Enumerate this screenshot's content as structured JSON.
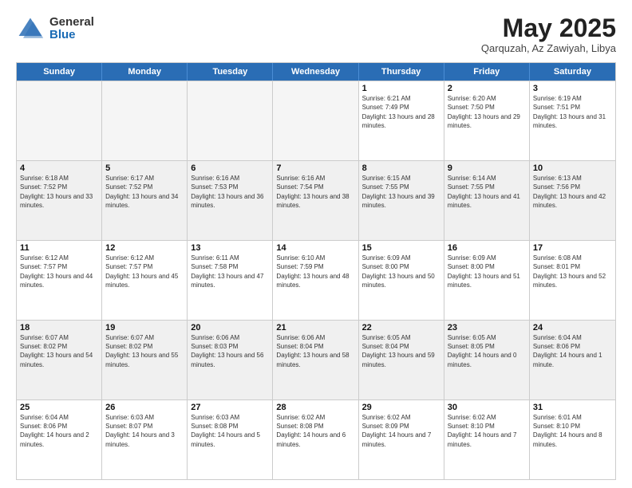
{
  "header": {
    "logo_general": "General",
    "logo_blue": "Blue",
    "month_title": "May 2025",
    "location": "Qarquzah, Az Zawiyah, Libya"
  },
  "weekdays": [
    "Sunday",
    "Monday",
    "Tuesday",
    "Wednesday",
    "Thursday",
    "Friday",
    "Saturday"
  ],
  "rows": [
    [
      {
        "day": "",
        "empty": true
      },
      {
        "day": "",
        "empty": true
      },
      {
        "day": "",
        "empty": true
      },
      {
        "day": "",
        "empty": true
      },
      {
        "day": "1",
        "sunrise": "6:21 AM",
        "sunset": "7:49 PM",
        "daylight": "13 hours and 28 minutes."
      },
      {
        "day": "2",
        "sunrise": "6:20 AM",
        "sunset": "7:50 PM",
        "daylight": "13 hours and 29 minutes."
      },
      {
        "day": "3",
        "sunrise": "6:19 AM",
        "sunset": "7:51 PM",
        "daylight": "13 hours and 31 minutes."
      }
    ],
    [
      {
        "day": "4",
        "sunrise": "6:18 AM",
        "sunset": "7:52 PM",
        "daylight": "13 hours and 33 minutes."
      },
      {
        "day": "5",
        "sunrise": "6:17 AM",
        "sunset": "7:52 PM",
        "daylight": "13 hours and 34 minutes."
      },
      {
        "day": "6",
        "sunrise": "6:16 AM",
        "sunset": "7:53 PM",
        "daylight": "13 hours and 36 minutes."
      },
      {
        "day": "7",
        "sunrise": "6:16 AM",
        "sunset": "7:54 PM",
        "daylight": "13 hours and 38 minutes."
      },
      {
        "day": "8",
        "sunrise": "6:15 AM",
        "sunset": "7:55 PM",
        "daylight": "13 hours and 39 minutes."
      },
      {
        "day": "9",
        "sunrise": "6:14 AM",
        "sunset": "7:55 PM",
        "daylight": "13 hours and 41 minutes."
      },
      {
        "day": "10",
        "sunrise": "6:13 AM",
        "sunset": "7:56 PM",
        "daylight": "13 hours and 42 minutes."
      }
    ],
    [
      {
        "day": "11",
        "sunrise": "6:12 AM",
        "sunset": "7:57 PM",
        "daylight": "13 hours and 44 minutes."
      },
      {
        "day": "12",
        "sunrise": "6:12 AM",
        "sunset": "7:57 PM",
        "daylight": "13 hours and 45 minutes."
      },
      {
        "day": "13",
        "sunrise": "6:11 AM",
        "sunset": "7:58 PM",
        "daylight": "13 hours and 47 minutes."
      },
      {
        "day": "14",
        "sunrise": "6:10 AM",
        "sunset": "7:59 PM",
        "daylight": "13 hours and 48 minutes."
      },
      {
        "day": "15",
        "sunrise": "6:09 AM",
        "sunset": "8:00 PM",
        "daylight": "13 hours and 50 minutes."
      },
      {
        "day": "16",
        "sunrise": "6:09 AM",
        "sunset": "8:00 PM",
        "daylight": "13 hours and 51 minutes."
      },
      {
        "day": "17",
        "sunrise": "6:08 AM",
        "sunset": "8:01 PM",
        "daylight": "13 hours and 52 minutes."
      }
    ],
    [
      {
        "day": "18",
        "sunrise": "6:07 AM",
        "sunset": "8:02 PM",
        "daylight": "13 hours and 54 minutes."
      },
      {
        "day": "19",
        "sunrise": "6:07 AM",
        "sunset": "8:02 PM",
        "daylight": "13 hours and 55 minutes."
      },
      {
        "day": "20",
        "sunrise": "6:06 AM",
        "sunset": "8:03 PM",
        "daylight": "13 hours and 56 minutes."
      },
      {
        "day": "21",
        "sunrise": "6:06 AM",
        "sunset": "8:04 PM",
        "daylight": "13 hours and 58 minutes."
      },
      {
        "day": "22",
        "sunrise": "6:05 AM",
        "sunset": "8:04 PM",
        "daylight": "13 hours and 59 minutes."
      },
      {
        "day": "23",
        "sunrise": "6:05 AM",
        "sunset": "8:05 PM",
        "daylight": "14 hours and 0 minutes."
      },
      {
        "day": "24",
        "sunrise": "6:04 AM",
        "sunset": "8:06 PM",
        "daylight": "14 hours and 1 minute."
      }
    ],
    [
      {
        "day": "25",
        "sunrise": "6:04 AM",
        "sunset": "8:06 PM",
        "daylight": "14 hours and 2 minutes."
      },
      {
        "day": "26",
        "sunrise": "6:03 AM",
        "sunset": "8:07 PM",
        "daylight": "14 hours and 3 minutes."
      },
      {
        "day": "27",
        "sunrise": "6:03 AM",
        "sunset": "8:08 PM",
        "daylight": "14 hours and 5 minutes."
      },
      {
        "day": "28",
        "sunrise": "6:02 AM",
        "sunset": "8:08 PM",
        "daylight": "14 hours and 6 minutes."
      },
      {
        "day": "29",
        "sunrise": "6:02 AM",
        "sunset": "8:09 PM",
        "daylight": "14 hours and 7 minutes."
      },
      {
        "day": "30",
        "sunrise": "6:02 AM",
        "sunset": "8:10 PM",
        "daylight": "14 hours and 7 minutes."
      },
      {
        "day": "31",
        "sunrise": "6:01 AM",
        "sunset": "8:10 PM",
        "daylight": "14 hours and 8 minutes."
      }
    ]
  ]
}
